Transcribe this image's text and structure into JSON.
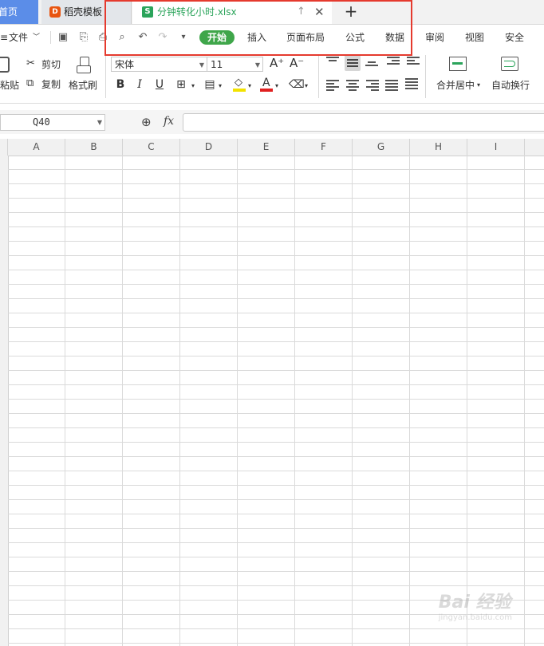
{
  "tabs": {
    "home": "首页",
    "template": "稻壳模板",
    "file": "分钟转化小时.xlsx",
    "file_icon": "S",
    "template_icon": "D",
    "new_tab": "+"
  },
  "menu": {
    "file": "文件",
    "items": [
      "开始",
      "插入",
      "页面布局",
      "公式",
      "数据",
      "审阅",
      "视图",
      "安全"
    ],
    "active": "开始"
  },
  "ribbon": {
    "paste": "粘贴",
    "cut": "剪切",
    "copy": "复制",
    "format_painter": "格式刷",
    "font_name": "宋体",
    "font_size": "11",
    "merge_center": "合并居中",
    "auto_wrap": "自动换行",
    "increase_font": "A⁺",
    "decrease_font": "A⁻"
  },
  "formula_bar": {
    "cell_ref": "Q40",
    "fx_label": "fx",
    "value": ""
  },
  "columns": [
    "A",
    "B",
    "C",
    "D",
    "E",
    "F",
    "G",
    "H",
    "I"
  ],
  "watermark": {
    "main": "Bai 经验",
    "sub": "jingyan.baidu.com"
  },
  "colors": {
    "accent_green": "#3fa64a",
    "home_tab": "#5b8de8",
    "highlight_red": "#e53a2e"
  }
}
